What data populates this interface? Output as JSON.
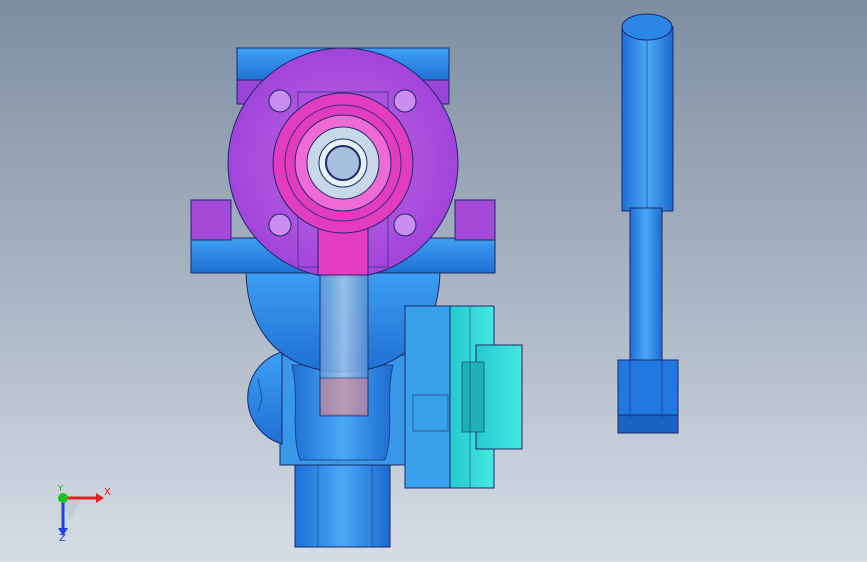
{
  "viewport": {
    "background_top": "#7e8ea2",
    "background_bottom": "#d6dde6"
  },
  "model": {
    "colors": {
      "body_blue": "#2f8ee8",
      "flange_purple": "#a74be0",
      "stem_magenta": "#e23cbf",
      "cap_cyan": "#2fd7d4",
      "handle_blue": "#1f78e0",
      "edge": "#1a2a6a"
    }
  },
  "triad": {
    "x_label": "X",
    "y_label": "Y",
    "z_label": "Z",
    "x_color": "#e02020",
    "y_color": "#20c020",
    "z_color": "#2040e0"
  }
}
